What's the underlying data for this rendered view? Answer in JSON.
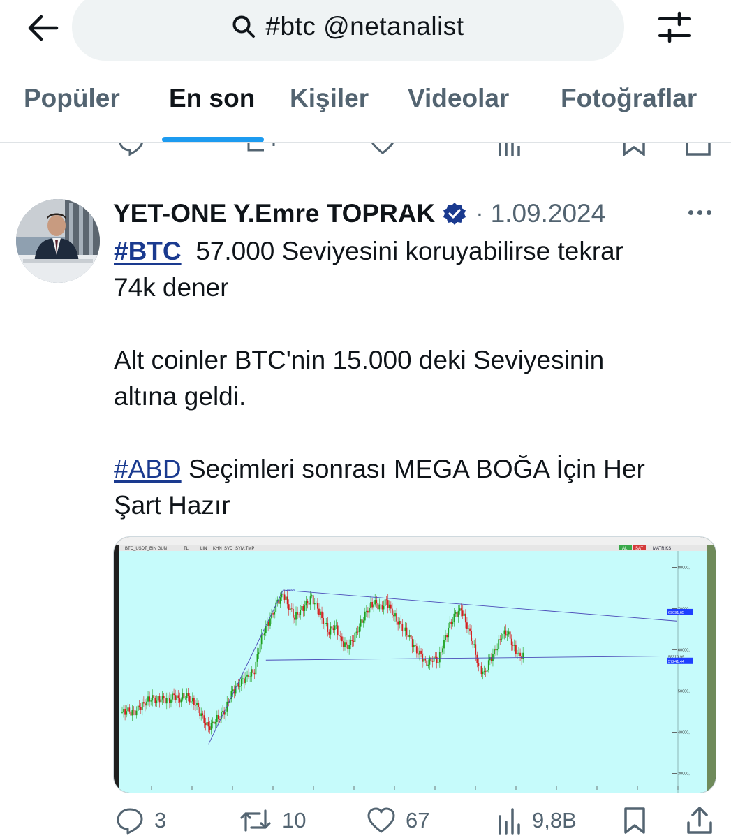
{
  "search": {
    "query": "#btc @netanalist"
  },
  "tabs": [
    {
      "label": "Popüler"
    },
    {
      "label": "En son"
    },
    {
      "label": "Kişiler"
    },
    {
      "label": "Videolar"
    },
    {
      "label": "Fotoğraflar"
    }
  ],
  "active_tab_index": 1,
  "tweet": {
    "author": "YET-ONE Y.Emre TOPRAK",
    "separator": "·",
    "date": "1.09.2024",
    "text": {
      "tag1": "#BTC",
      "line1": "57.000 Seviyesini koruyabilirse tekrar",
      "line2": "74k dener",
      "line3": "Alt coinler BTC'nin 15.000 deki Seviyesinin",
      "line4": "altına geldi.",
      "tag2": "#ABD",
      "line5": "Seçimleri sonrası MEGA BOĞA İçin Her",
      "line6": "Şart Hazır"
    },
    "stats": {
      "replies": "3",
      "retweets": "10",
      "likes": "67",
      "views": "9,8B"
    }
  },
  "chart_image": {
    "symbol_bar": "BTC_USDT_BIN  GUN",
    "toolbar_items": [
      "TL",
      "LIN",
      "KHN",
      "SVD",
      "SYM:TMP"
    ],
    "toolbar_right": [
      "AL",
      "SAT",
      "MATRIKS"
    ],
    "price_labels": [
      "80000,",
      "70000,",
      "69091,65",
      "60000,",
      "58310,99",
      "57241,44",
      "50000,",
      "40000,",
      "30000,"
    ],
    "peak_label": "73,58",
    "colors": {
      "background": "#c6fbfb",
      "up": "#1ea01e",
      "down": "#d42020",
      "trendline": "#4b4bb8",
      "label_blue": "#1f3fff"
    }
  },
  "chart_data": {
    "type": "line",
    "title": "BTC_USDT_BIN  GUN",
    "xlabel": "",
    "ylabel": "",
    "ylim": [
      26000,
      84000
    ],
    "y_ticks": [
      30000,
      40000,
      50000,
      60000,
      70000,
      80000
    ],
    "series": [
      {
        "values": [
          44800,
          45200,
          44500,
          46000,
          47200,
          48500,
          47800,
          48200,
          47500,
          48800,
          47900,
          49200,
          47800,
          46500,
          43200,
          41000,
          42500,
          44000,
          45500,
          49500,
          51000,
          52500,
          53800,
          55000,
          62000,
          65500,
          68000,
          71500,
          73580,
          70500,
          68000,
          69500,
          71000,
          72500,
          70000,
          67000,
          64500,
          66000,
          62500,
          60500,
          62000,
          65000,
          68000,
          70500,
          71500,
          70000,
          71800,
          69000,
          67000,
          65000,
          63000,
          60000,
          58500,
          56500,
          58000,
          57500,
          62000,
          66000,
          68500,
          69800,
          66000,
          62000,
          56000,
          54000,
          57500,
          60000,
          63500,
          64500,
          61000,
          58500
        ]
      }
    ],
    "annotations": [
      "69091,65",
      "58310,99",
      "57241,44",
      "73,58"
    ]
  }
}
